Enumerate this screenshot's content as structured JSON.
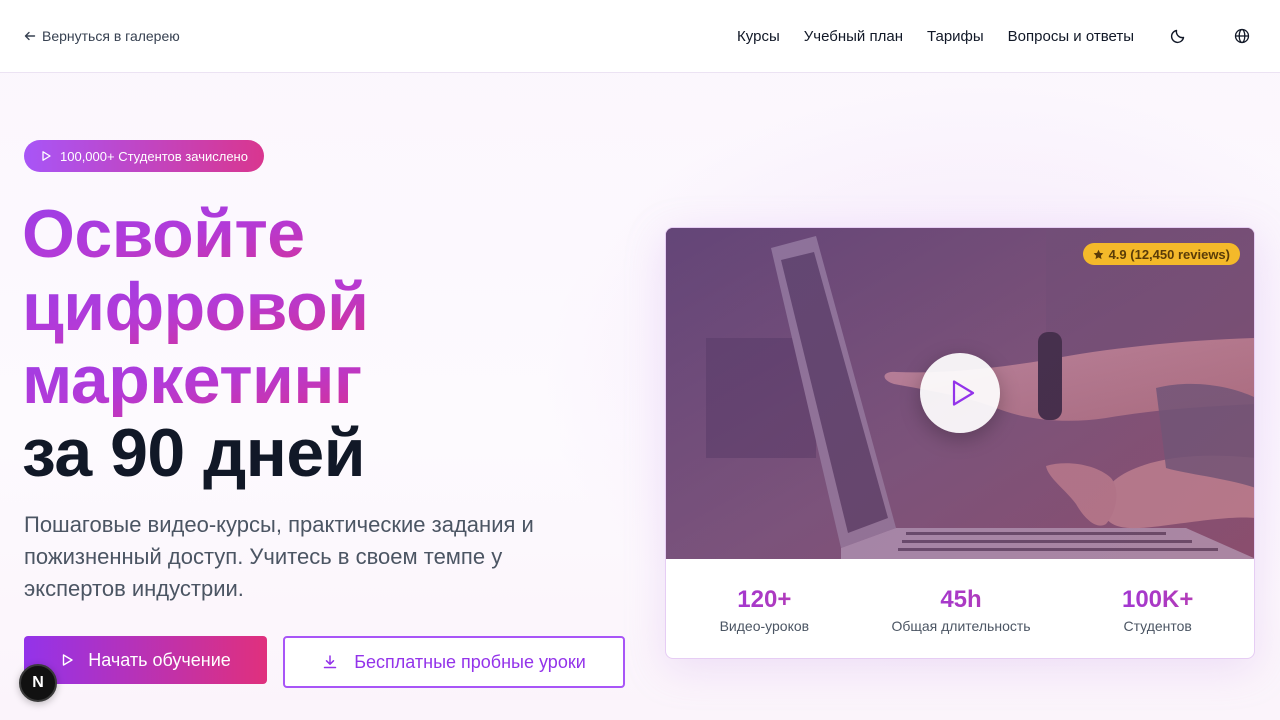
{
  "header": {
    "back_label": "Вернуться в галерею",
    "nav": [
      {
        "label": "Курсы"
      },
      {
        "label": "Учебный план"
      },
      {
        "label": "Тарифы"
      },
      {
        "label": "Вопросы и ответы"
      }
    ],
    "theme_icon": "moon-icon",
    "language_icon": "globe-icon"
  },
  "hero": {
    "badge": "100,000+ Студентов зачислено",
    "headline": {
      "line1": "Освойте",
      "line2": "цифровой",
      "line3": "маркетинг",
      "line4": "за 90 дней"
    },
    "subtitle": "Пошаговые видео-курсы, практические задания и пожизненный доступ. Учитесь в своем темпе у экспертов индустрии.",
    "primary_button": "Начать обучение",
    "secondary_button": "Бесплатные пробные уроки"
  },
  "video_card": {
    "rating": "4.9 (12,450 reviews)",
    "stats": [
      {
        "value": "120+",
        "label": "Видео-уроков"
      },
      {
        "value": "45h",
        "label": "Общая длительность"
      },
      {
        "value": "100K+",
        "label": "Студентов"
      }
    ]
  },
  "dev_badge": "N",
  "colors": {
    "accent_purple": "#9333ea",
    "accent_pink": "#e0307d",
    "rating_bg": "#f4b92a"
  }
}
